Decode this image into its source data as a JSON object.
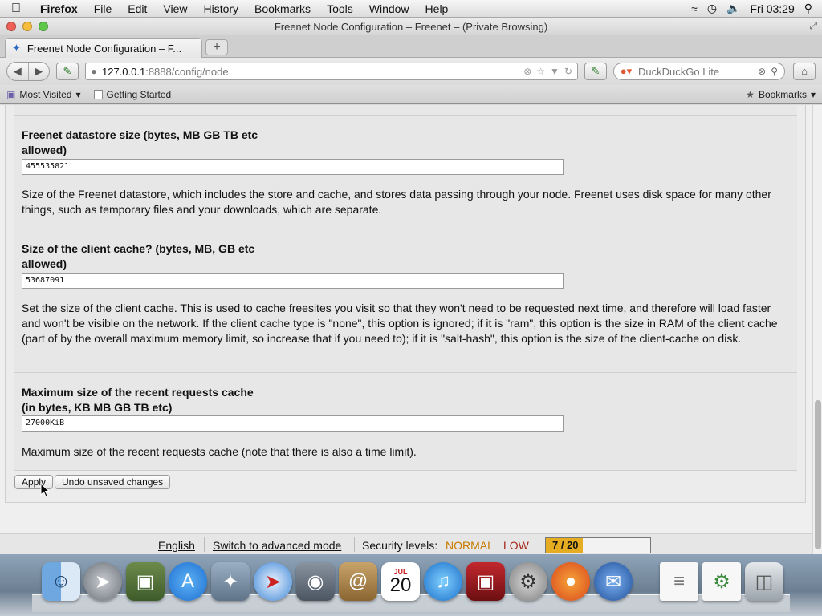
{
  "menubar": {
    "app": "Firefox",
    "menus": [
      "File",
      "Edit",
      "View",
      "History",
      "Bookmarks",
      "Tools",
      "Window",
      "Help"
    ],
    "clock": "Fri 03:29",
    "status_icons": [
      "network-icon",
      "time-machine-icon",
      "volume-icon"
    ]
  },
  "window": {
    "title": "Freenet Node Configuration – Freenet – (Private Browsing)"
  },
  "tab": {
    "title": "Freenet Node Configuration – F..."
  },
  "navbar": {
    "url_host": "127.0.0.1",
    "url_rest": ":8888/config/node",
    "search_placeholder": "DuckDuckGo Lite"
  },
  "bookmarks": {
    "most_visited": "Most Visited",
    "getting_started": "Getting Started",
    "bookmarks_menu": "Bookmarks"
  },
  "options": [
    {
      "label": "Freenet datastore size (bytes, MB GB TB etc allowed)",
      "value": "455535821",
      "description": "Size of the Freenet datastore, which includes the store and cache, and stores data passing through your node. Freenet uses disk space for many other things, such as temporary files and your downloads, which are separate."
    },
    {
      "label": "Size of the client cache? (bytes, MB, GB etc allowed)",
      "value": "53687091",
      "description": "Set the size of the client cache. This is used to cache freesites you visit so that they won't need to be requested next time, and therefore will load faster and won't be visible on the network. If the client cache type is \"none\", this option is ignored; if it is \"ram\", this option is the size in RAM of the client cache (part of by the overall maximum memory limit, so increase that if you need to); if it is \"salt-hash\", this option is the size of the client-cache on disk."
    },
    {
      "label": "Maximum size of the recent requests cache (in bytes, KB MB GB TB etc)",
      "value": "27000KiB",
      "description": "Maximum size of the recent requests cache (note that there is also a time limit)."
    }
  ],
  "buttons": {
    "apply": "Apply",
    "undo": "Undo unsaved changes"
  },
  "footer": {
    "language": "English",
    "advanced_mode": "Switch to advanced mode",
    "security_label": "Security levels:",
    "network_level": "NORMAL",
    "physical_level": "LOW",
    "peers_text": "7 / 20",
    "peers_fraction": 0.35,
    "colors": {
      "normal": "#c87a00",
      "low": "#a8251c",
      "bar": "#e6ad22"
    }
  },
  "dock": {
    "icons": [
      "finder-icon",
      "launchpad-icon",
      "preview-icon",
      "app-store-icon",
      "feather-icon",
      "safari-icon",
      "facetime-icon",
      "address-book-icon",
      "calendar-icon",
      "itunes-icon",
      "photo-booth-icon",
      "system-preferences-icon",
      "firefox-icon",
      "thunderbird-icon",
      "document-icon",
      "document-icon-2",
      "trash-icon"
    ],
    "calendar_day": "20",
    "calendar_month": "JUL"
  }
}
